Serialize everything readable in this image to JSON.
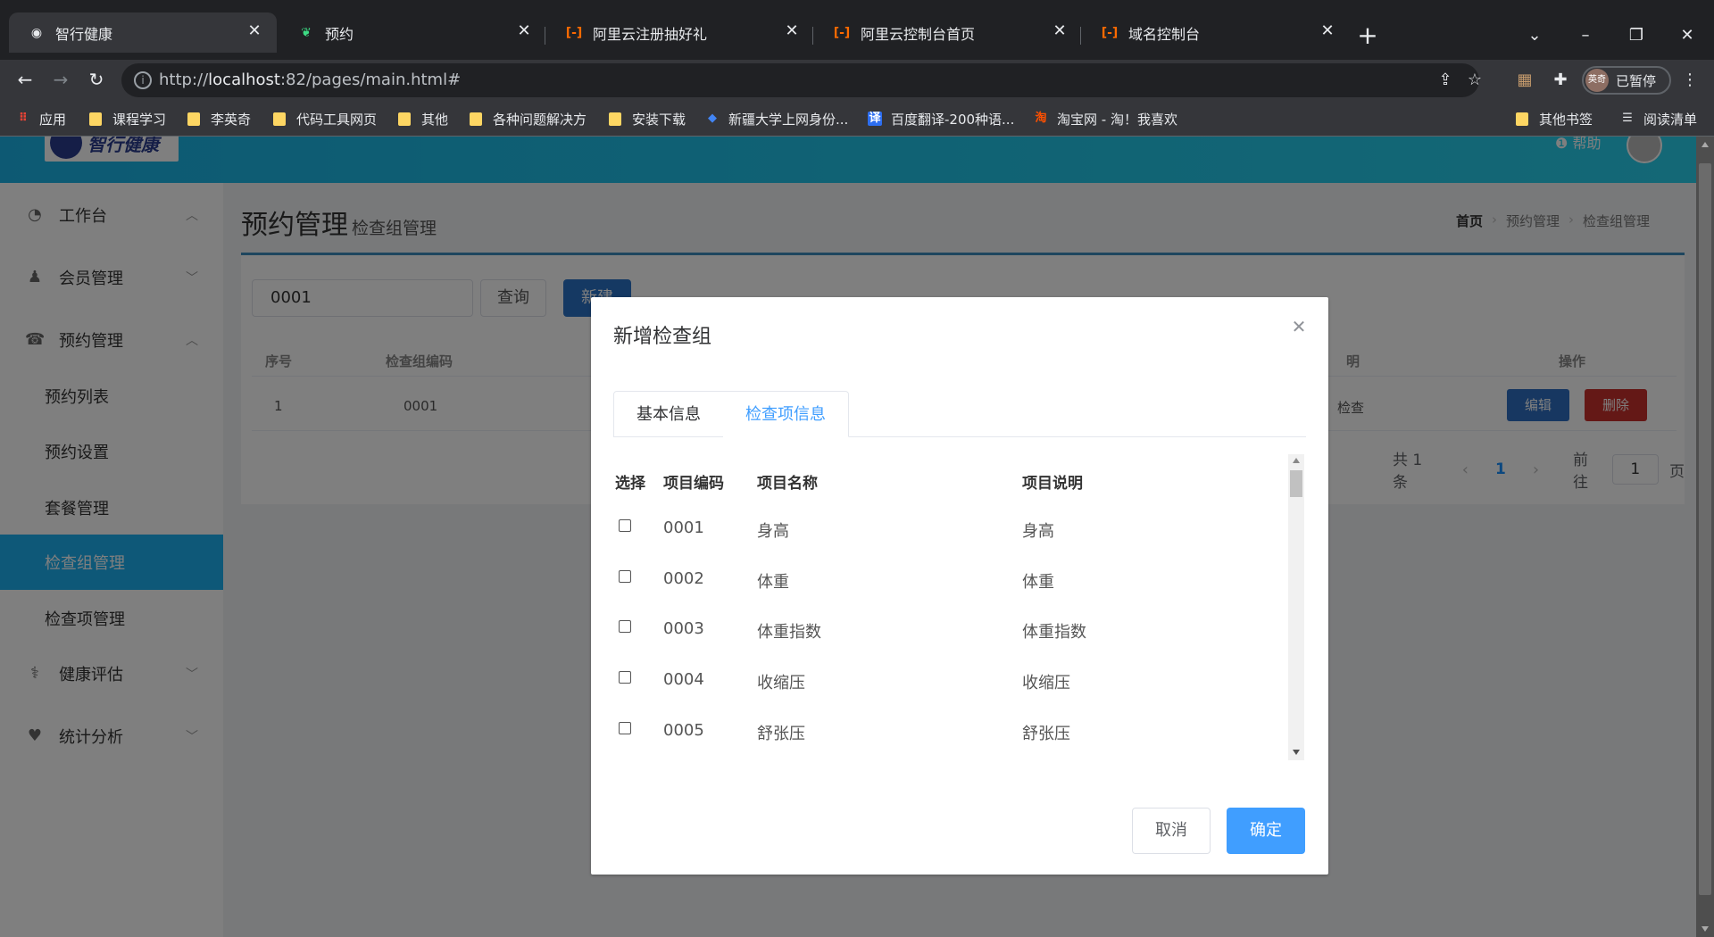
{
  "browser": {
    "tabs": [
      {
        "title": "智行健康",
        "active": true
      },
      {
        "title": "预约"
      },
      {
        "title": "阿里云注册抽好礼"
      },
      {
        "title": "阿里云控制台首页"
      },
      {
        "title": "域名控制台"
      }
    ],
    "url_prefix": "http://",
    "url_host": "localhost",
    "url_rest": ":82/pages/main.html#",
    "profile_label": "已暂停",
    "profile_avatar_text": "英奇",
    "bookmarks": [
      {
        "label": "应用",
        "icon": "apps-grid-icon"
      },
      {
        "label": "课程学习",
        "icon": "folder-icon"
      },
      {
        "label": "李英奇",
        "icon": "folder-icon"
      },
      {
        "label": "代码工具网页",
        "icon": "folder-icon"
      },
      {
        "label": "其他",
        "icon": "folder-icon"
      },
      {
        "label": "各种问题解决方",
        "icon": "folder-icon"
      },
      {
        "label": "安装下载",
        "icon": "folder-icon"
      },
      {
        "label": "新疆大学上网身份...",
        "icon": "globe-icon"
      },
      {
        "label": "百度翻译-200种语...",
        "icon": "translate-icon"
      },
      {
        "label": "淘宝网 - 淘！我喜欢",
        "icon": "taobao-icon"
      },
      {
        "label": "其他书签",
        "icon": "folder-icon"
      },
      {
        "label": "阅读清单",
        "icon": "reading-list-icon"
      }
    ]
  },
  "header": {
    "logo_text": "智行健康",
    "help_label": "帮助"
  },
  "sidebar": {
    "items": [
      {
        "label": "工作台",
        "icon": "dashboard-icon",
        "arrow": "^"
      },
      {
        "label": "会员管理",
        "icon": "user-icon",
        "arrow": "v"
      },
      {
        "label": "预约管理",
        "icon": "phone-icon",
        "arrow": "^"
      },
      {
        "label": "健康评估",
        "icon": "stethoscope-icon",
        "arrow": "v"
      },
      {
        "label": "统计分析",
        "icon": "heartbeat-icon",
        "arrow": "v"
      }
    ],
    "sub_items": [
      {
        "label": "预约列表"
      },
      {
        "label": "预约设置"
      },
      {
        "label": "套餐管理"
      },
      {
        "label": "检查组管理",
        "active": true
      },
      {
        "label": "检查项管理"
      }
    ]
  },
  "page": {
    "title": "预约管理",
    "subtitle": "检查组管理",
    "breadcrumb": [
      "首页",
      "预约管理",
      "检查组管理"
    ],
    "search_value": "0001",
    "query_label": "查询",
    "new_label": "新建",
    "table_headers": [
      "序号",
      "检查组编码",
      "明",
      "操作"
    ],
    "row": {
      "index": "1",
      "code": "0001",
      "desc": "检查"
    },
    "edit_label": "编辑",
    "delete_label": "删除",
    "pager": {
      "total": "共 1 条",
      "current": "1",
      "goto_label": "前往",
      "goto_value": "1",
      "page_suffix": "页"
    }
  },
  "dialog": {
    "title": "新增检查组",
    "tabs": [
      "基本信息",
      "检查项信息"
    ],
    "active_tab": 1,
    "columns": [
      "选择",
      "项目编码",
      "项目名称",
      "项目说明"
    ],
    "items": [
      {
        "code": "0001",
        "name": "身高",
        "desc": "身高",
        "checked": false
      },
      {
        "code": "0002",
        "name": "体重",
        "desc": "体重",
        "checked": false
      },
      {
        "code": "0003",
        "name": "体重指数",
        "desc": "体重指数",
        "checked": false
      },
      {
        "code": "0004",
        "name": "收缩压",
        "desc": "收缩压",
        "checked": false
      },
      {
        "code": "0005",
        "name": "舒张压",
        "desc": "舒张压",
        "checked": false
      }
    ],
    "cancel_label": "取消",
    "ok_label": "确定"
  },
  "colors": {
    "header_gradient_start": "#1ab3e6",
    "active_menu": "#1cb1f0",
    "primary": "#409eff",
    "danger": "#c9302c"
  }
}
